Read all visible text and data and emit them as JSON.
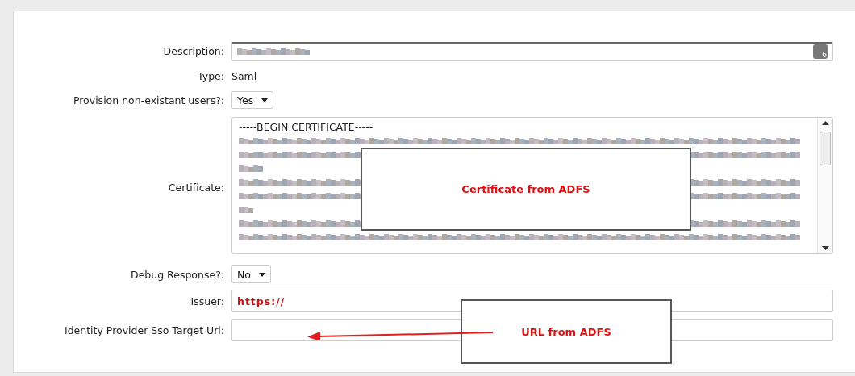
{
  "form": {
    "rows": [
      {
        "kind": "text",
        "label": "Description:",
        "blurred": true,
        "badge": "6"
      },
      {
        "kind": "static",
        "label": "Type:",
        "value": "Saml"
      },
      {
        "kind": "select",
        "label": "Provision non-existant users?:",
        "value": "Yes"
      },
      {
        "kind": "textarea",
        "label": "Certificate:",
        "first_line": "-----BEGIN CERTIFICATE-----",
        "blurred": true
      },
      {
        "kind": "select",
        "label": "Debug Response?:",
        "value": "No"
      },
      {
        "kind": "text",
        "label": "Issuer:",
        "value": "https://",
        "emphasis": true
      },
      {
        "kind": "text",
        "label": "Identity Provider Sso Target Url:"
      }
    ]
  },
  "callouts": [
    {
      "text": "Certificate from ADFS",
      "arrow": false
    },
    {
      "text": "URL from ADFS",
      "arrow": true
    }
  ]
}
